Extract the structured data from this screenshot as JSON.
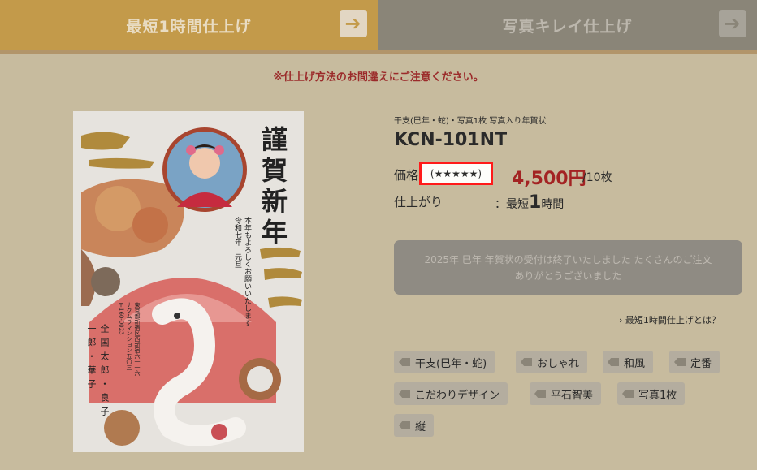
{
  "tabs": [
    {
      "label": "最短1時間仕上げ",
      "arrow": "➔"
    },
    {
      "label": "写真キレイ仕上げ",
      "arrow": "➔"
    }
  ],
  "notice": "※仕上げ方法のお間違えにご注意ください。",
  "card": {
    "title_chars": [
      "謹",
      "賀",
      "新",
      "年"
    ],
    "greeting_lines": [
      "本年もよろしくお願いいたします",
      "令和七年　元旦"
    ],
    "address_lines": [
      "東京都新宿区西新宿六一一六",
      "ナクムラマンション五〇三",
      "〒160-0023"
    ],
    "names": [
      "全国太郎・良子",
      "一郎・華子"
    ]
  },
  "product": {
    "subtitle": "干支(巳年・蛇)・写真1枚 写真入り年賀状",
    "code": "KCN-101NT",
    "price_label": "価格",
    "rating": "(★★★★★)",
    "price": "4,500円",
    "price_unit": "/10枚",
    "finish_label": "仕上がり",
    "finish_prefix": "：最短",
    "finish_number": "1",
    "finish_suffix": "時間"
  },
  "closed_message": {
    "line1": "2025年 巳年 年賀状の受付は終了いたしました たくさんのご注文",
    "line2": "ありがとうございました"
  },
  "link": "最短1時間仕上げとは？",
  "tags": [
    "干支(巳年・蛇)",
    "おしゃれ",
    "和風",
    "定番",
    "こだわりデザイン",
    "平石智美",
    "写真1枚",
    "縦"
  ],
  "colors": {
    "accent_gold": "#c39a4a",
    "price_red": "#a32323",
    "highlight_red": "#ff1a1a",
    "background": "#c7bb9e"
  }
}
